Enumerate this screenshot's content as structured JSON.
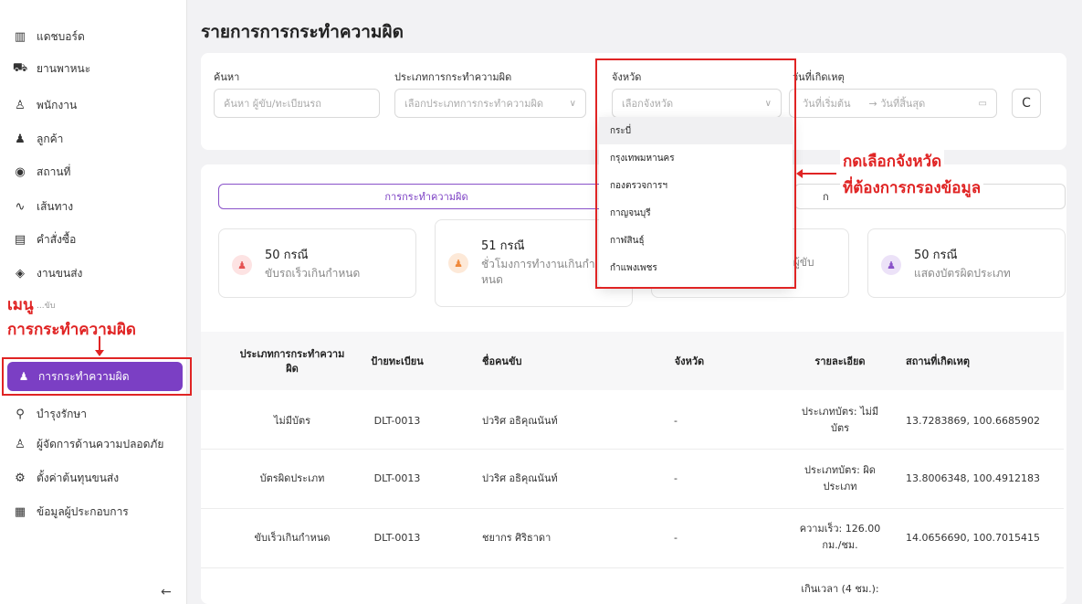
{
  "sidebar": {
    "items": [
      {
        "label": "แดชบอร์ด",
        "icon": "chart-icon"
      },
      {
        "label": "ยานพาหนะ",
        "icon": "truck-icon"
      },
      {
        "label": "พนักงาน",
        "icon": "user-icon"
      },
      {
        "label": "ลูกค้า",
        "icon": "users-icon"
      },
      {
        "label": "สถานที่",
        "icon": "location-icon"
      },
      {
        "label": "เส้นทาง",
        "icon": "route-icon"
      },
      {
        "label": "คำสั่งซื้อ",
        "icon": "clipboard-icon"
      },
      {
        "label": "งานขนส่ง",
        "icon": "box-icon"
      },
      {
        "label": "...ขับ",
        "icon": "partial-icon"
      },
      {
        "label": "การกระทำความผิด",
        "icon": "violation-icon"
      },
      {
        "label": "บำรุงรักษา",
        "icon": "wrench-icon"
      },
      {
        "label": "ผู้จัดการด้านความปลอดภัย",
        "icon": "shield-user-icon"
      },
      {
        "label": "ตั้งค่าต้นทุนขนส่ง",
        "icon": "gear-icon"
      },
      {
        "label": "ข้อมูลผู้ประกอบการ",
        "icon": "building-icon"
      }
    ],
    "collapse_glyph": "←"
  },
  "annotations": {
    "menu_line1": "เมนู",
    "menu_line2": "การกระทำความผิด",
    "dropdown_line1": "กดเลือกจังหวัด",
    "dropdown_line2": "ที่ต้องการกรองข้อมูล",
    "color": "#e02424"
  },
  "page": {
    "title": "รายการการกระทำความผิด"
  },
  "filters": {
    "search_label": "ค้นหา",
    "search_placeholder": "ค้นหา ผู้ขับ/ทะเบียนรถ",
    "type_label": "ประเภทการกระทำความผิด",
    "type_placeholder": "เลือกประเภทการกระทำความผิด",
    "province_label": "จังหวัด",
    "province_placeholder": "เลือกจังหวัด",
    "date_label": "วันที่เกิดเหตุ",
    "date_start": "วันที่เริ่มต้น",
    "date_end": "→ วันที่สิ้นสุด",
    "refresh_glyph": "C"
  },
  "province_options": [
    "กระบี่",
    "กรุงเทพมหานคร",
    "กองตรวจการฯ",
    "กาญจนบุรี",
    "กาฬสินธุ์",
    "กำแพงเพชร"
  ],
  "tabs": {
    "active": "การกระทำความผิด",
    "second_partial": "ก"
  },
  "stats": [
    {
      "count": "50 กรณี",
      "desc": "ขับรถเร็วเกินกำหนด",
      "color": "#e55353"
    },
    {
      "count": "51 กรณี",
      "desc1": "ชั่วโมงการทำงานเกินกำ",
      "desc2": "หนด",
      "color": "#f08a3c"
    },
    {
      "count": "",
      "desc": "วผู้ขับ",
      "color": "#2f8fd8"
    },
    {
      "count": "50 กรณี",
      "desc": "แสดงบัตรผิดประเภท",
      "color": "#8a52c9"
    }
  ],
  "table": {
    "headers": [
      "ประเภทการกระทำความ",
      "ผิด",
      "ป้ายทะเบียน",
      "ชื่อคนขับ",
      "จังหวัด",
      "รายละเอียด",
      "สถานที่เกิดเหตุ"
    ],
    "rows": [
      {
        "type": "ไม่มีบัตร",
        "plate": "DLT-0013",
        "driver": "ปวริศ อธิคุณนันท์",
        "province": "-",
        "detail1": "ประเภทบัตร: ไม่มี",
        "detail2": "บัตร",
        "location": "13.7283869, 100.6685902"
      },
      {
        "type": "บัตรผิดประเภท",
        "plate": "DLT-0013",
        "driver": "ปวริศ อธิคุณนันท์",
        "province": "-",
        "detail1": "ประเภทบัตร: ผิด",
        "detail2": "ประเภท",
        "location": "13.8006348, 100.4912183"
      },
      {
        "type": "ขับเร็วเกินกำหนด",
        "plate": "DLT-0013",
        "driver": "ชยากร ศิริธาดา",
        "province": "-",
        "detail1": "ความเร็ว: 126.00",
        "detail2": "กม./ชม.",
        "location": "14.0656690, 100.7015415"
      },
      {
        "detail1": "เกินเวลา (4 ชม.):"
      }
    ]
  }
}
